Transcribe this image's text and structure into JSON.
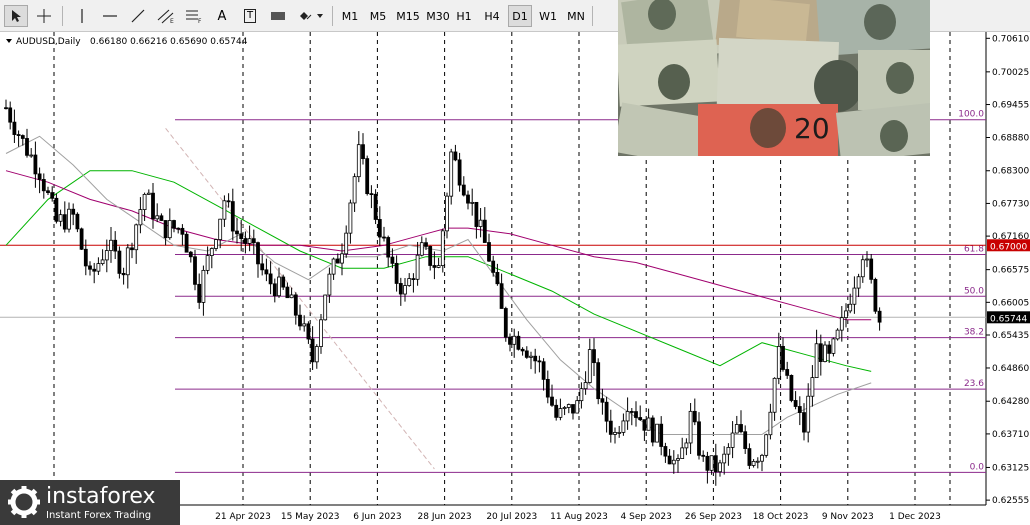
{
  "toolbar": {
    "tools": [
      {
        "icon": "cursor-arrow-icon"
      },
      {
        "icon": "crosshair-icon"
      },
      {
        "icon": "vertical-line-icon"
      },
      {
        "icon": "horizontal-line-icon"
      },
      {
        "icon": "trend-line-icon"
      },
      {
        "icon": "equidistant-channel-icon"
      },
      {
        "icon": "fibonacci-retracement-icon"
      },
      {
        "icon": "text-label-icon",
        "text": "A"
      },
      {
        "icon": "text-box-icon",
        "text": "T"
      },
      {
        "icon": "rectangle-icon"
      },
      {
        "icon": "shapes-dropdown-icon"
      }
    ],
    "timeframes": [
      "M1",
      "M5",
      "M15",
      "M30",
      "H1",
      "H4",
      "D1",
      "W1",
      "MN"
    ],
    "active_timeframe": "D1"
  },
  "chart_data": {
    "type": "candlestick",
    "title": "AUDUSD,Daily",
    "ohlc_text": "0.66180 0.66216 0.65690 0.65744",
    "ylim": [
      0.6247,
      0.7072
    ],
    "y_ticks": [
      "0.70610",
      "0.70025",
      "0.69455",
      "0.68880",
      "0.68300",
      "0.67730",
      "0.67160",
      "0.66575",
      "0.66005",
      "0.65435",
      "0.64860",
      "0.64280",
      "0.63710",
      "0.63125",
      "0.62555"
    ],
    "x_tick_labels": [
      "14 Feb 2023",
      "21 Apr 2023",
      "15 May 2023",
      "6 Jun 2023",
      "28 Jun 2023",
      "20 Jul 2023",
      "11 Aug 2023",
      "4 Sep 2023",
      "26 Sep 2023",
      "18 Oct 2023",
      "9 Nov 2023",
      "1 Dec 2023"
    ],
    "x_tick_positions": [
      0,
      45,
      61,
      77,
      93,
      109,
      125,
      141,
      157,
      173,
      189,
      205
    ],
    "num_bars": 212,
    "price_anchors": [
      [
        0,
        0.694
      ],
      [
        4,
        0.688
      ],
      [
        8,
        0.683
      ],
      [
        12,
        0.674
      ],
      [
        16,
        0.675
      ],
      [
        20,
        0.664
      ],
      [
        24,
        0.67
      ],
      [
        28,
        0.666
      ],
      [
        33,
        0.679
      ],
      [
        37,
        0.673
      ],
      [
        42,
        0.673
      ],
      [
        46,
        0.662
      ],
      [
        52,
        0.678
      ],
      [
        55,
        0.672
      ],
      [
        58,
        0.67
      ],
      [
        62,
        0.664
      ],
      [
        66,
        0.662
      ],
      [
        70,
        0.657
      ],
      [
        73,
        0.65
      ],
      [
        76,
        0.662
      ],
      [
        80,
        0.67
      ],
      [
        84,
        0.686
      ],
      [
        87,
        0.678
      ],
      [
        92,
        0.665
      ],
      [
        95,
        0.662
      ],
      [
        99,
        0.669
      ],
      [
        103,
        0.666
      ],
      [
        106,
        0.686
      ],
      [
        110,
        0.679
      ],
      [
        115,
        0.668
      ],
      [
        119,
        0.655
      ],
      [
        123,
        0.653
      ],
      [
        127,
        0.649
      ],
      [
        131,
        0.64
      ],
      [
        136,
        0.642
      ],
      [
        139,
        0.651
      ],
      [
        142,
        0.641
      ],
      [
        145,
        0.637
      ],
      [
        148,
        0.643
      ],
      [
        151,
        0.64
      ],
      [
        156,
        0.636
      ],
      [
        160,
        0.631
      ],
      [
        163,
        0.64
      ],
      [
        166,
        0.632
      ],
      [
        170,
        0.631
      ],
      [
        174,
        0.638
      ],
      [
        177,
        0.633
      ],
      [
        180,
        0.634
      ],
      [
        184,
        0.651
      ],
      [
        187,
        0.643
      ],
      [
        190,
        0.638
      ],
      [
        193,
        0.652
      ],
      [
        196,
        0.65
      ],
      [
        199,
        0.656
      ],
      [
        202,
        0.664
      ],
      [
        204,
        0.669
      ],
      [
        206,
        0.663
      ],
      [
        208,
        0.657
      ]
    ],
    "current_price": 0.65744,
    "marked_level": 0.67,
    "marked_level_label": "0.67000",
    "current_price_label": "0.65744",
    "fibonacci": [
      {
        "label": "100.0",
        "price": 0.6919
      },
      {
        "label": "61.8",
        "price": 0.6684
      },
      {
        "label": "50.0",
        "price": 0.6611
      },
      {
        "label": "38.2",
        "price": 0.6539
      },
      {
        "label": "23.6",
        "price": 0.6449
      },
      {
        "label": "0.0",
        "price": 0.6304
      }
    ],
    "moving_averages": [
      {
        "color": "#00b400",
        "points": [
          [
            0,
            0.67
          ],
          [
            10,
            0.678
          ],
          [
            20,
            0.683
          ],
          [
            30,
            0.683
          ],
          [
            40,
            0.681
          ],
          [
            50,
            0.677
          ],
          [
            60,
            0.673
          ],
          [
            70,
            0.669
          ],
          [
            80,
            0.666
          ],
          [
            90,
            0.666
          ],
          [
            100,
            0.668
          ],
          [
            110,
            0.668
          ],
          [
            120,
            0.665
          ],
          [
            130,
            0.662
          ],
          [
            140,
            0.658
          ],
          [
            150,
            0.655
          ],
          [
            160,
            0.652
          ],
          [
            170,
            0.649
          ],
          [
            180,
            0.653
          ],
          [
            190,
            0.651
          ],
          [
            200,
            0.649
          ],
          [
            206,
            0.648
          ]
        ]
      },
      {
        "color": "#a0006e",
        "points": [
          [
            0,
            0.683
          ],
          [
            10,
            0.681
          ],
          [
            20,
            0.678
          ],
          [
            30,
            0.676
          ],
          [
            40,
            0.673
          ],
          [
            50,
            0.671
          ],
          [
            60,
            0.67
          ],
          [
            70,
            0.67
          ],
          [
            80,
            0.669
          ],
          [
            90,
            0.67
          ],
          [
            100,
            0.672
          ],
          [
            105,
            0.673
          ],
          [
            110,
            0.673
          ],
          [
            120,
            0.672
          ],
          [
            130,
            0.67
          ],
          [
            140,
            0.668
          ],
          [
            150,
            0.667
          ],
          [
            160,
            0.665
          ],
          [
            170,
            0.663
          ],
          [
            180,
            0.661
          ],
          [
            190,
            0.659
          ],
          [
            200,
            0.657
          ],
          [
            206,
            0.657
          ]
        ]
      },
      {
        "color": "#a0a0a0",
        "points": [
          [
            0,
            0.686
          ],
          [
            8,
            0.689
          ],
          [
            16,
            0.684
          ],
          [
            24,
            0.678
          ],
          [
            32,
            0.674
          ],
          [
            40,
            0.67
          ],
          [
            48,
            0.669
          ],
          [
            56,
            0.672
          ],
          [
            64,
            0.667
          ],
          [
            72,
            0.664
          ],
          [
            80,
            0.668
          ],
          [
            88,
            0.668
          ],
          [
            96,
            0.67
          ],
          [
            104,
            0.669
          ],
          [
            110,
            0.671
          ],
          [
            116,
            0.665
          ],
          [
            124,
            0.657
          ],
          [
            132,
            0.65
          ],
          [
            140,
            0.645
          ],
          [
            148,
            0.641
          ],
          [
            156,
            0.637
          ],
          [
            164,
            0.637
          ],
          [
            172,
            0.637
          ],
          [
            180,
            0.637
          ],
          [
            186,
            0.64
          ],
          [
            192,
            0.642
          ],
          [
            198,
            0.644
          ],
          [
            206,
            0.646
          ]
        ]
      }
    ],
    "trendline": {
      "color": "#d2b4b4",
      "from": [
        38,
        0.6904
      ],
      "to": [
        102,
        0.631
      ]
    }
  },
  "watermark": {
    "name": "instaforex",
    "tagline": "Instant Forex Trading"
  },
  "photo": {
    "banknote_value": "20"
  }
}
